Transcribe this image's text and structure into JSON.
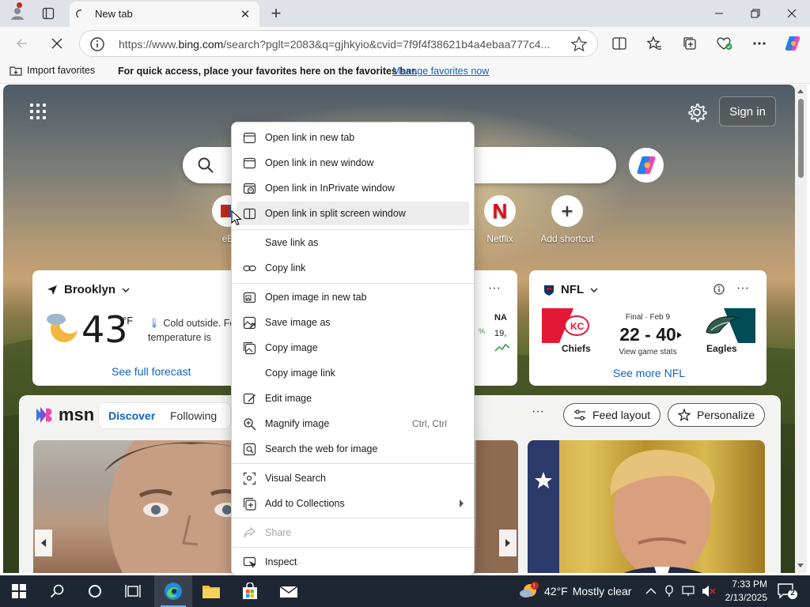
{
  "browser": {
    "tab": {
      "title": "New tab"
    },
    "address_bar": {
      "url_prefix": "https://www.",
      "url_domain": "bing.com",
      "url_rest": "/search?pglt=2083&q=gjhkyio&cvid=7f9f4f38621b4a4ebaa777c4..."
    },
    "favorites_bar": {
      "import_label": "Import favorites",
      "hint": "For quick access, place your favorites here on the favorites bar.",
      "manage_link": "Manage favorites now"
    }
  },
  "newtab": {
    "sign_in": "Sign in",
    "shortcuts": [
      {
        "label": "eB"
      },
      {
        "label": "Netflix"
      },
      {
        "label": "Add shortcut"
      }
    ],
    "weather": {
      "location": "Brooklyn",
      "temp": "43",
      "unit": "°F",
      "description": "Cold outside. Fe like temperature is",
      "forecast_link": "See full forecast"
    },
    "market": {
      "frag1": "NA",
      "frag2": "19,",
      "frag3": "%"
    },
    "nfl": {
      "title": "NFL",
      "status": "Final · Feb 9",
      "score": "22 - 40",
      "stats_link": "View game stats",
      "home_team": "Chiefs",
      "away_team": "Eagles",
      "more_link": "See more NFL"
    },
    "feed": {
      "brand": "msn",
      "tabs": [
        "Discover",
        "Following"
      ],
      "feed_layout": "Feed layout",
      "personalize": "Personalize"
    }
  },
  "context_menu": {
    "items": [
      {
        "label": "Open link in new tab",
        "icon": "new-tab-icon"
      },
      {
        "label": "Open link in new window",
        "icon": "window-icon"
      },
      {
        "label": "Open link in InPrivate window",
        "icon": "inprivate-icon"
      },
      {
        "label": "Open link in split screen window",
        "icon": "split-screen-icon"
      },
      {
        "label": "Save link as",
        "icon": ""
      },
      {
        "label": "Copy link",
        "icon": "link-icon"
      },
      {
        "label": "Open image in new tab",
        "icon": "image-new-tab-icon"
      },
      {
        "label": "Save image as",
        "icon": "save-image-icon"
      },
      {
        "label": "Copy image",
        "icon": "copy-image-icon"
      },
      {
        "label": "Copy image link",
        "icon": ""
      },
      {
        "label": "Edit image",
        "icon": "edit-image-icon"
      },
      {
        "label": "Magnify image",
        "icon": "magnify-icon",
        "shortcut": "Ctrl, Ctrl"
      },
      {
        "label": "Search the web for image",
        "icon": "search-image-icon"
      },
      {
        "label": "Visual Search",
        "icon": "visual-search-icon"
      },
      {
        "label": "Add to Collections",
        "icon": "collections-icon"
      },
      {
        "label": "Share",
        "icon": "share-icon"
      },
      {
        "label": "Inspect",
        "icon": "inspect-icon"
      }
    ]
  },
  "taskbar": {
    "weather_temp": "42°F",
    "weather_desc": "Mostly clear",
    "time": "7:33 PM",
    "date": "2/13/2025",
    "notification_count": "2"
  },
  "colors": {
    "accent": "#0f62c4",
    "taskbar": "#1e2533",
    "netflix_red": "#e50914",
    "chiefs_red": "#e31837",
    "eagles_green": "#004c54"
  }
}
